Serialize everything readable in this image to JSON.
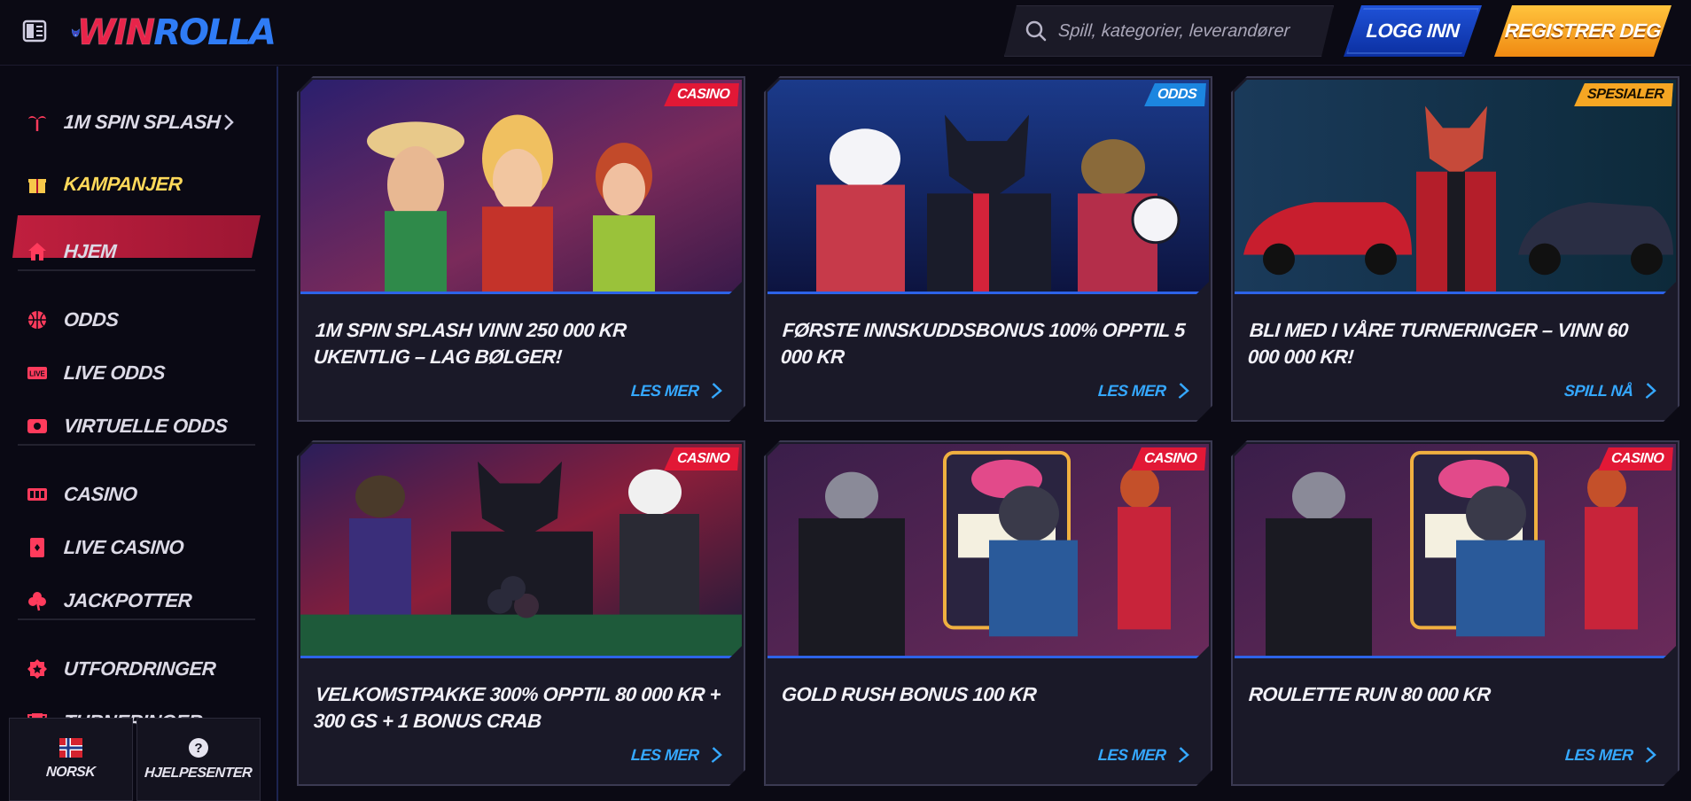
{
  "header": {
    "logo_win": "WIN",
    "logo_rolla": "ROLLA",
    "search_placeholder": "Spill, kategorier, leverandører",
    "login_label": "LOGG INN",
    "register_label": "REGISTRER DEG"
  },
  "sidebar": {
    "items": [
      {
        "label": "1M SPIN SPLASH",
        "icon": "palm-icon"
      },
      {
        "label": "KAMPANJER",
        "icon": "gift-icon"
      },
      {
        "label": "HJEM",
        "icon": "home-icon"
      },
      {
        "label": "ODDS",
        "icon": "basketball-icon"
      },
      {
        "label": "LIVE ODDS",
        "icon": "live-icon"
      },
      {
        "label": "VIRTUELLE ODDS",
        "icon": "virtual-icon"
      },
      {
        "label": "CASINO",
        "icon": "slot-icon"
      },
      {
        "label": "LIVE CASINO",
        "icon": "card-icon"
      },
      {
        "label": "JACKPOTTER",
        "icon": "clover-icon"
      },
      {
        "label": "UTFORDRINGER",
        "icon": "badge-icon"
      },
      {
        "label": "TURNERINGER",
        "icon": "trophy-icon"
      }
    ],
    "language_label": "NORSK",
    "help_label": "HJELPESENTER"
  },
  "cards": [
    {
      "tag": "CASINO",
      "title": "1M SPIN SPLASH VINN 250 000 KR UKENTLIG – LAG BØLGER!",
      "link": "LES MER"
    },
    {
      "tag": "ODDS",
      "title": "FØRSTE INNSKUDDSBONUS 100% OPPTIL 5 000 KR",
      "link": "LES MER"
    },
    {
      "tag": "SPESIALER",
      "title": "BLI MED I VÅRE TURNERINGER – VINN 60 000 000 KR!",
      "link": "SPILL NÅ"
    },
    {
      "tag": "CASINO",
      "title": "VELKOMSTPAKKE 300% OPPTIL 80 000 KR + 300 GS + 1 BONUS CRAB",
      "link": "LES MER"
    },
    {
      "tag": "CASINO",
      "title": "GOLD RUSH BONUS 100 KR",
      "link": "LES MER"
    },
    {
      "tag": "CASINO",
      "title": "ROULETTE RUN 80 000 KR",
      "link": "LES MER"
    }
  ],
  "colors": {
    "accent_red": "#e21836",
    "accent_blue": "#2f7cf6",
    "accent_orange": "#f5a623",
    "link_blue": "#35a8ff"
  }
}
